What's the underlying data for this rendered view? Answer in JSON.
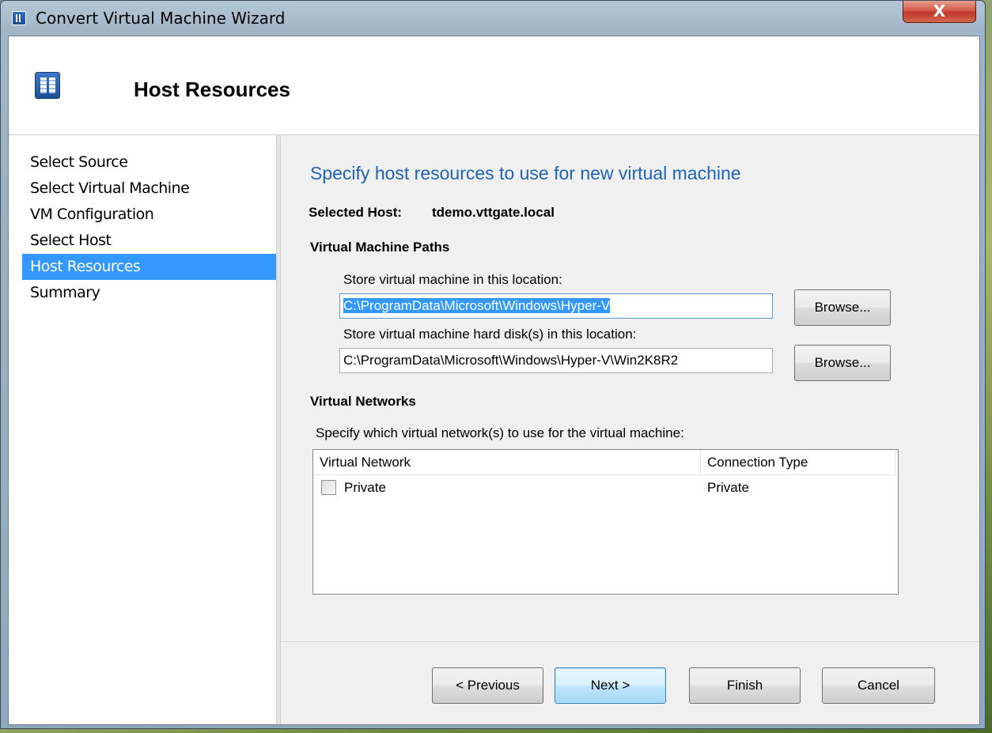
{
  "window": {
    "title": "Convert Virtual Machine Wizard",
    "close_label": "X"
  },
  "header": {
    "title": "Host Resources"
  },
  "nav": {
    "items": [
      {
        "label": "Select Source",
        "active": false
      },
      {
        "label": "Select Virtual Machine",
        "active": false
      },
      {
        "label": "VM Configuration",
        "active": false
      },
      {
        "label": "Select Host",
        "active": false
      },
      {
        "label": "Host Resources",
        "active": true
      },
      {
        "label": "Summary",
        "active": false
      }
    ]
  },
  "content": {
    "title": "Specify host resources to use for new virtual machine",
    "selected_host_label": "Selected Host:",
    "selected_host_value": "tdemo.vttgate.local",
    "paths_section": "Virtual Machine Paths",
    "vm_location_label": "Store virtual machine in this location:",
    "vm_location_value": "C:\\ProgramData\\Microsoft\\Windows\\Hyper-V",
    "disk_location_label": "Store virtual machine hard disk(s) in this location:",
    "disk_location_value": "C:\\ProgramData\\Microsoft\\Windows\\Hyper-V\\Win2K8R2",
    "browse_label": "Browse...",
    "networks_section": "Virtual Networks",
    "networks_desc": "Specify which virtual network(s) to use for the virtual machine:",
    "networks_table": {
      "columns": [
        "Virtual Network",
        "Connection Type"
      ],
      "rows": [
        {
          "name": "Private",
          "type": "Private",
          "checked": false
        }
      ]
    }
  },
  "buttons": {
    "previous": "< Previous",
    "next": "Next >",
    "finish": "Finish",
    "cancel": "Cancel"
  },
  "colors": {
    "accent": "#3399ff",
    "title_blue": "#1e63b6"
  },
  "icons": {
    "window": "wizard-window-icon",
    "header": "host-server-icon",
    "close": "close-icon"
  }
}
